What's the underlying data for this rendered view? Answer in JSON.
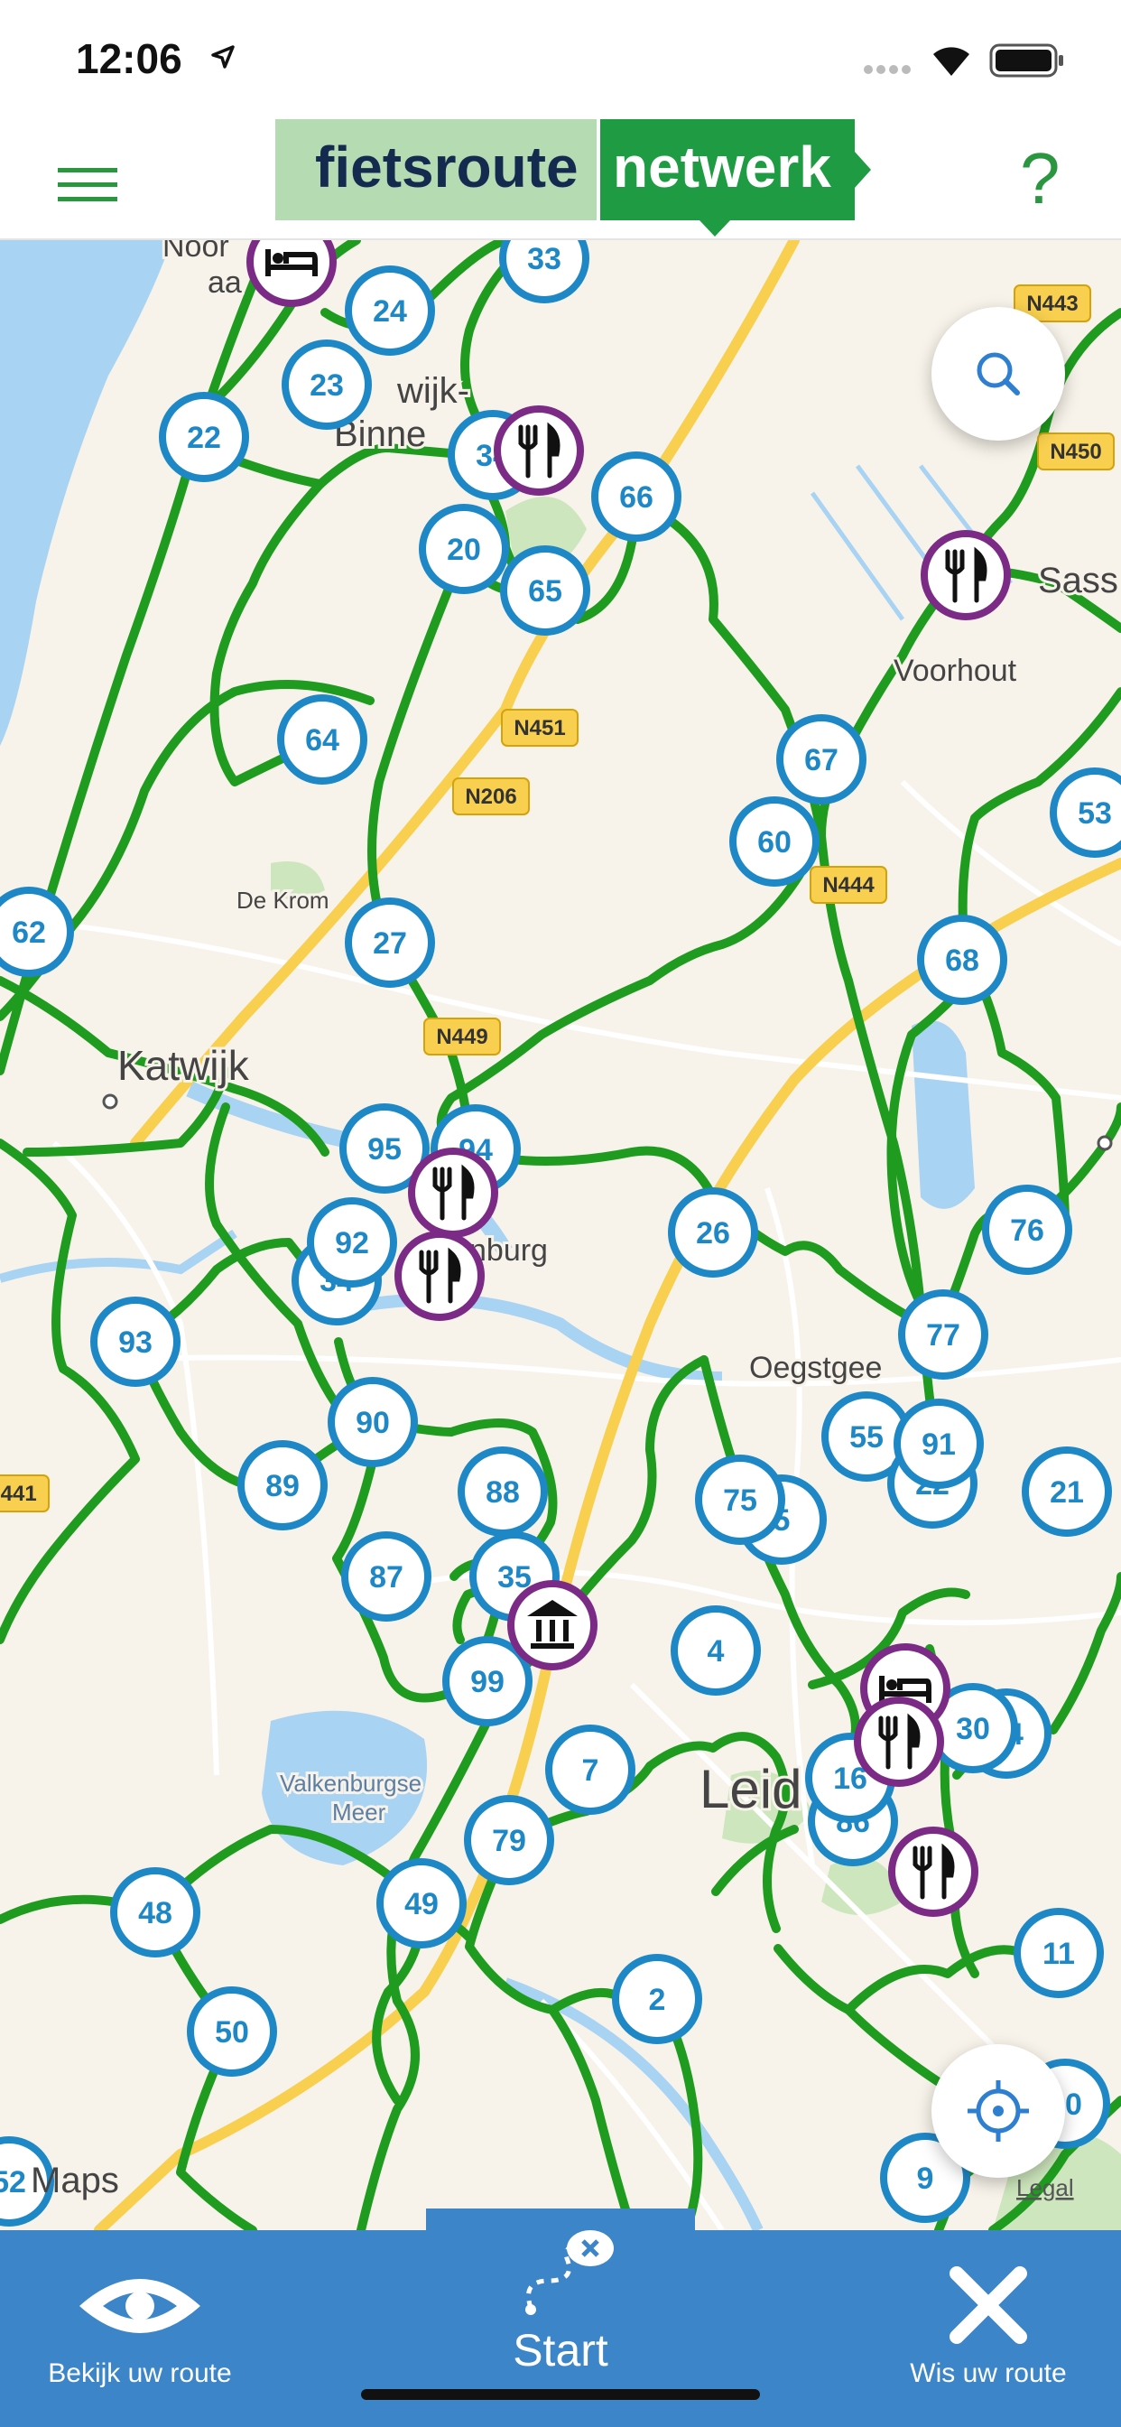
{
  "status_bar": {
    "time": "12:06"
  },
  "header": {
    "logo_left": "fietsroute",
    "logo_right": "netwerk",
    "help": "?"
  },
  "map": {
    "attribution": "Maps",
    "legal": "Legal",
    "place_labels": [
      {
        "text": "Katwijk",
        "id": "katwijk"
      },
      {
        "text": "Oegstgee",
        "id": "oegstgeest"
      },
      {
        "text": "Voorhout",
        "id": "voorhout"
      },
      {
        "text": "De Krom",
        "id": "de-krom"
      },
      {
        "text": "Valkenburgse",
        "id": "valkenburgse"
      },
      {
        "text": "Meer",
        "id": "meer"
      },
      {
        "text": "Leid",
        "id": "leiden"
      },
      {
        "text": "Sass",
        "id": "sass"
      },
      {
        "text": "nburg",
        "id": "rijnsburg"
      },
      {
        "text": "Noor",
        "id": "noordwijk"
      },
      {
        "text": "aa",
        "id": "aan-zee"
      },
      {
        "text": "N",
        "id": "noordwijk-binnen-n"
      },
      {
        "text": "wijk-",
        "id": "noordwijk-binnen-wijk"
      },
      {
        "text": "Binne",
        "id": "binnen"
      }
    ],
    "road_badges": [
      "N443",
      "N450",
      "N451",
      "N206",
      "N444",
      "N449",
      "N441"
    ],
    "nodes": [
      "33",
      "24",
      "23",
      "22",
      "34",
      "20",
      "65",
      "66",
      "64",
      "67",
      "60",
      "53",
      "62",
      "27",
      "68",
      "95",
      "94",
      "26",
      "76",
      "93",
      "34",
      "77",
      "90",
      "89",
      "88",
      "55",
      "22",
      "21",
      "87",
      "35",
      "5",
      "4",
      "99",
      "7",
      "14",
      "86",
      "79",
      "49",
      "48",
      "50",
      "2",
      "11",
      "9",
      "92",
      "91",
      "75",
      "16",
      "10",
      "52",
      "30"
    ],
    "pois": [
      "hotel",
      "restaurant",
      "restaurant",
      "restaurant",
      "restaurant",
      "museum",
      "hotel",
      "restaurant",
      "restaurant"
    ]
  },
  "bottom_bar": {
    "view_route_label": "Bekijk uw route",
    "start_label": "Start",
    "clear_route_label": "Wis uw route"
  }
}
